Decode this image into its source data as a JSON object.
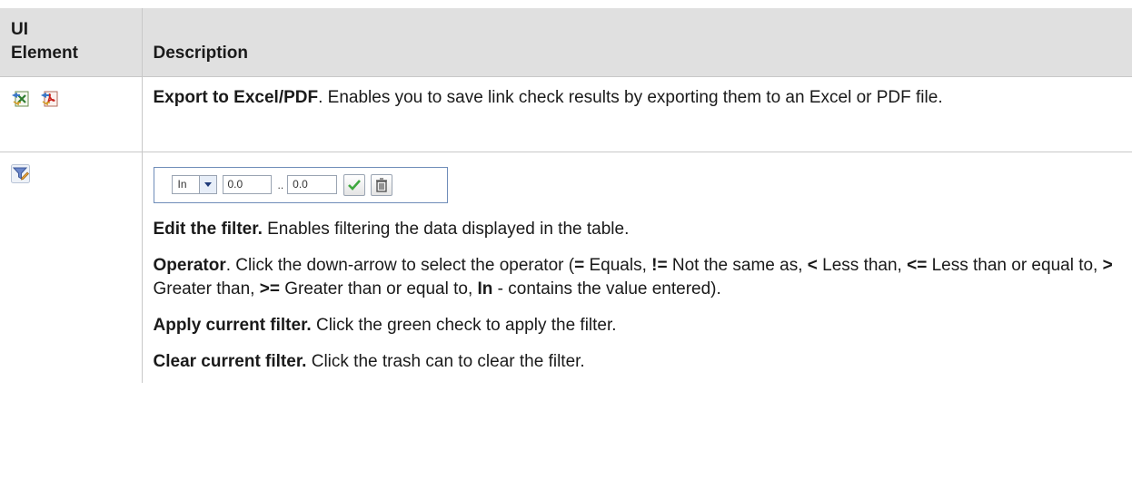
{
  "table": {
    "header": {
      "col1": "UI Element",
      "col1_line1": "UI",
      "col1_line2": "Element",
      "col2": "Description"
    },
    "rows": [
      {
        "icons": [
          "export-to-excel-icon",
          "export-to-pdf-icon"
        ],
        "title": "Export to Excel/PDF",
        "text": ". Enables you to save link check results by exporting them to an Excel or PDF file."
      },
      {
        "icons": [
          "edit-filter-icon"
        ],
        "filter_widget": {
          "operator": "In",
          "value_from": "0.0",
          "separator": "..",
          "value_to": "0.0"
        },
        "paragraphs": [
          {
            "bold": "Edit the filter.",
            "text": " Enables filtering the data displayed in the table."
          },
          {
            "bold": "Operator",
            "text": ". Click the down-arrow to select the operator (",
            "ops": [
              {
                "sym": "=",
                "desc": " Equals, "
              },
              {
                "sym": "!=",
                "desc": " Not the same as, "
              },
              {
                "sym": "<",
                "desc": " Less than, "
              },
              {
                "sym": "<=",
                "desc": " Less than or equal to, "
              },
              {
                "sym": ">",
                "desc": " Greater than, "
              },
              {
                "sym": ">=",
                "desc": " Greater than or equal to, "
              },
              {
                "sym": "In",
                "desc": " - contains the value entered)."
              }
            ]
          },
          {
            "bold": "Apply current filter.",
            "text": " Click the green check to apply the filter."
          },
          {
            "bold": "Clear current filter.",
            "text": " Click the trash can to clear the filter."
          }
        ]
      }
    ]
  },
  "colors": {
    "header_bg": "#e0e0e0",
    "border": "#c8c8c8",
    "widget_border": "#6f8db9",
    "check_green": "#3ea83e"
  }
}
